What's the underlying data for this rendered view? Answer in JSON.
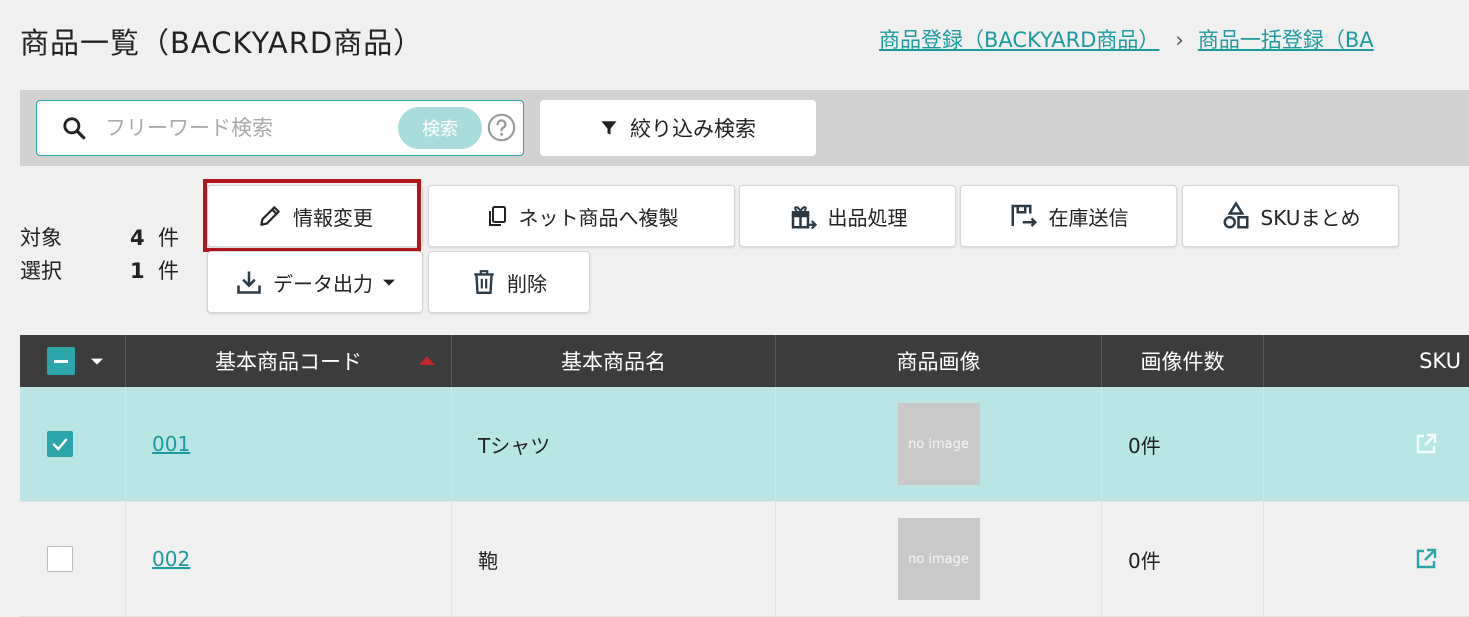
{
  "page": {
    "title": "商品一覧（BACKYARD商品）"
  },
  "breadcrumb": [
    {
      "label": "商品登録（BACKYARD商品）"
    },
    {
      "label": "商品一括登録（BA"
    }
  ],
  "search": {
    "placeholder": "フリーワード検索",
    "value": "",
    "button_label": "検索",
    "filter_label": "絞り込み検索"
  },
  "counts": {
    "target_label": "対象",
    "target_value": "4",
    "target_unit": "件",
    "selected_label": "選択",
    "selected_value": "1",
    "selected_unit": "件"
  },
  "actions": {
    "edit_info": "情報変更",
    "copy_to_net": "ネット商品へ複製",
    "listing": "出品処理",
    "stock_send": "在庫送信",
    "sku_merge": "SKUまとめ",
    "data_export": "データ出力",
    "delete": "削除"
  },
  "table": {
    "headers": {
      "code": "基本商品コード",
      "name": "基本商品名",
      "image": "商品画像",
      "image_count": "画像件数",
      "sku": "SKU"
    },
    "rows": [
      {
        "selected": true,
        "code": "001",
        "name": "Tシャツ",
        "image": "no image",
        "image_count": "0件"
      },
      {
        "selected": false,
        "code": "002",
        "name": "鞄",
        "image": "no image",
        "image_count": "0件"
      }
    ]
  },
  "colors": {
    "accent": "#2ba6ab",
    "link": "#1c9aa0",
    "highlight_border": "#b0161c",
    "selected_row": "#b9e6e4",
    "header_bg": "#3c3c3c"
  },
  "icons": [
    "search-icon",
    "help-icon",
    "filter-icon",
    "pencil-icon",
    "copy-icon",
    "gift-icon",
    "stock-send-icon",
    "shapes-icon",
    "download-icon",
    "trash-icon",
    "sort-asc-icon",
    "chevron-down-icon",
    "external-link-icon",
    "checkbox-indeterminate-icon"
  ]
}
